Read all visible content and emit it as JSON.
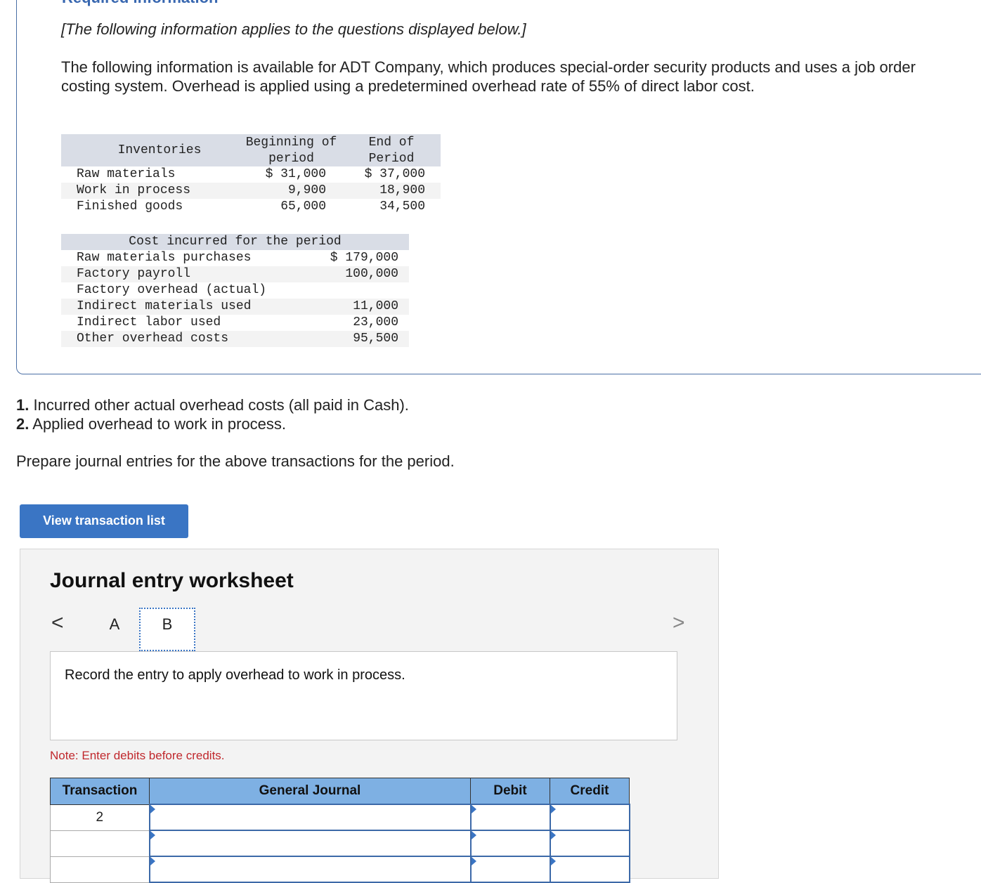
{
  "required_info_title": "Required information",
  "italic_note": "[The following information applies to the questions displayed below.]",
  "intro": "The following information is available for ADT Company, which produces special-order security products and uses a job order costing system. Overhead is applied using a predetermined overhead rate of 55% of direct labor cost.",
  "inventories": {
    "header_label": "Inventories",
    "header_begin_1": "Beginning of",
    "header_begin_2": "period",
    "header_end_1": "End of",
    "header_end_2": "Period",
    "rows": [
      {
        "label": "Raw materials",
        "begin": "$ 31,000",
        "end": "$ 37,000"
      },
      {
        "label": "Work in process",
        "begin": "9,900",
        "end": "18,900"
      },
      {
        "label": "Finished goods",
        "begin": "65,000",
        "end": "34,500"
      }
    ]
  },
  "costs": {
    "header": "Cost incurred for the period",
    "rows": [
      {
        "label": "Raw materials purchases",
        "value": "$ 179,000"
      },
      {
        "label": "Factory payroll",
        "value": "100,000"
      },
      {
        "label": "Factory overhead (actual)",
        "value": ""
      },
      {
        "label": "Indirect materials used",
        "value": "11,000"
      },
      {
        "label": "Indirect labor used",
        "value": "23,000"
      },
      {
        "label": "Other overhead costs",
        "value": "95,500"
      }
    ]
  },
  "questions": [
    {
      "num": "1.",
      "text": "Incurred other actual overhead costs (all paid in Cash)."
    },
    {
      "num": "2.",
      "text": "Applied overhead to work in process."
    }
  ],
  "prepare_text": "Prepare journal entries for the above transactions for the period.",
  "view_button": "View transaction list",
  "worksheet": {
    "title": "Journal entry worksheet",
    "nav_prev": "<",
    "nav_next": ">",
    "tabs": [
      "A",
      "B"
    ],
    "prompt": "Record the entry to apply overhead to work in process.",
    "note": "Note: Enter debits before credits.",
    "columns": [
      "Transaction",
      "General Journal",
      "Debit",
      "Credit"
    ],
    "rows": [
      {
        "transaction": "2"
      },
      {
        "transaction": ""
      },
      {
        "transaction": ""
      }
    ]
  }
}
